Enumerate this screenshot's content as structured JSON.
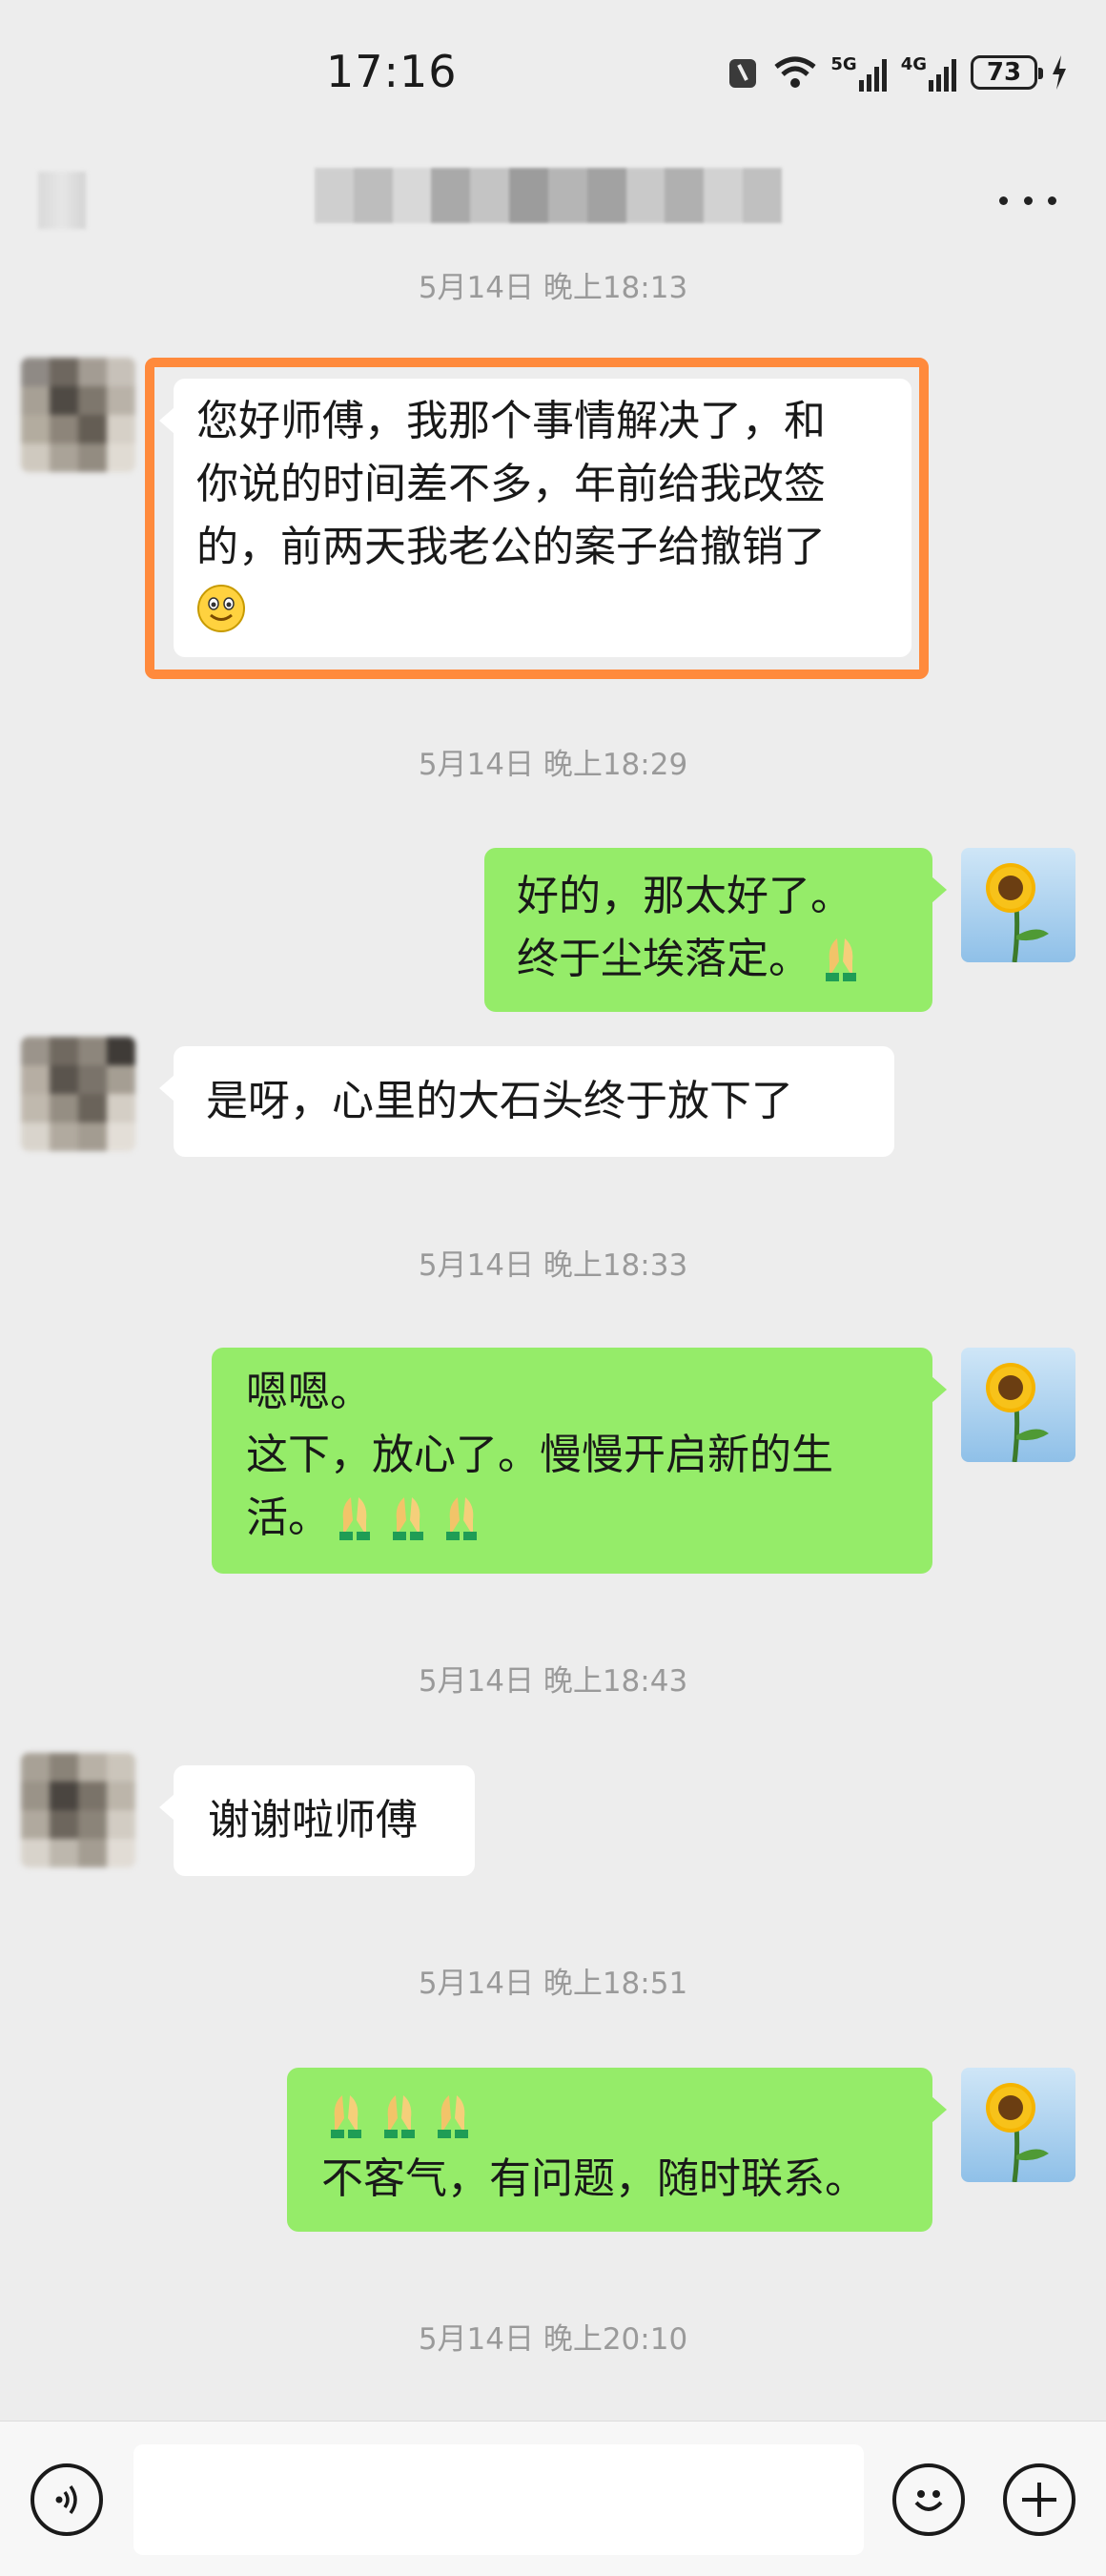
{
  "status_bar": {
    "time": "17:16",
    "network_1": "5G",
    "network_2": "4G",
    "battery": "73"
  },
  "header": {
    "back_icon": "back-icon-blurred",
    "title_blurred": true,
    "more_icon": "more-dots-icon"
  },
  "messages": [
    {
      "type": "timestamp",
      "text": "5月14日 晚上18:13"
    },
    {
      "type": "in",
      "lines": [
        "您好师傅，我那个事情解决了，和",
        "你说的时间差不多，年前给我改签",
        "的，前两天我老公的案子给撤销了"
      ],
      "emoji": "smile-emoji",
      "highlighted": true,
      "highlight_color": "#ff8a3c"
    },
    {
      "type": "timestamp",
      "text": "5月14日 晚上18:29"
    },
    {
      "type": "out",
      "lines": [
        "好的，那太好了。",
        "终于尘埃落定。"
      ],
      "emoji": "pray-emoji"
    },
    {
      "type": "in",
      "lines": [
        "是呀，心里的大石头终于放下了"
      ]
    },
    {
      "type": "timestamp",
      "text": "5月14日 晚上18:33"
    },
    {
      "type": "out",
      "lines": [
        "嗯嗯。",
        "这下，放心了。慢慢开启新的生",
        "活。"
      ],
      "emoji": "pray-emoji x3"
    },
    {
      "type": "timestamp",
      "text": "5月14日 晚上18:43"
    },
    {
      "type": "in",
      "lines": [
        "谢谢啦师傅"
      ]
    },
    {
      "type": "timestamp",
      "text": "5月14日 晚上18:51"
    },
    {
      "type": "out",
      "lines": [
        "",
        "不客气，有问题，随时联系。"
      ],
      "emoji": "pray-emoji x3"
    },
    {
      "type": "timestamp",
      "text": "5月14日 晚上20:10"
    }
  ],
  "input_bar": {
    "voice_icon": "voice-icon",
    "text_value": "",
    "emoji_icon": "emoji-icon",
    "plus_icon": "plus-icon"
  },
  "colors": {
    "background": "#ededed",
    "bubble_out": "#95ec69",
    "bubble_in": "#ffffff",
    "highlight": "#ff8a3c",
    "timestamp": "#9a9a9a"
  }
}
